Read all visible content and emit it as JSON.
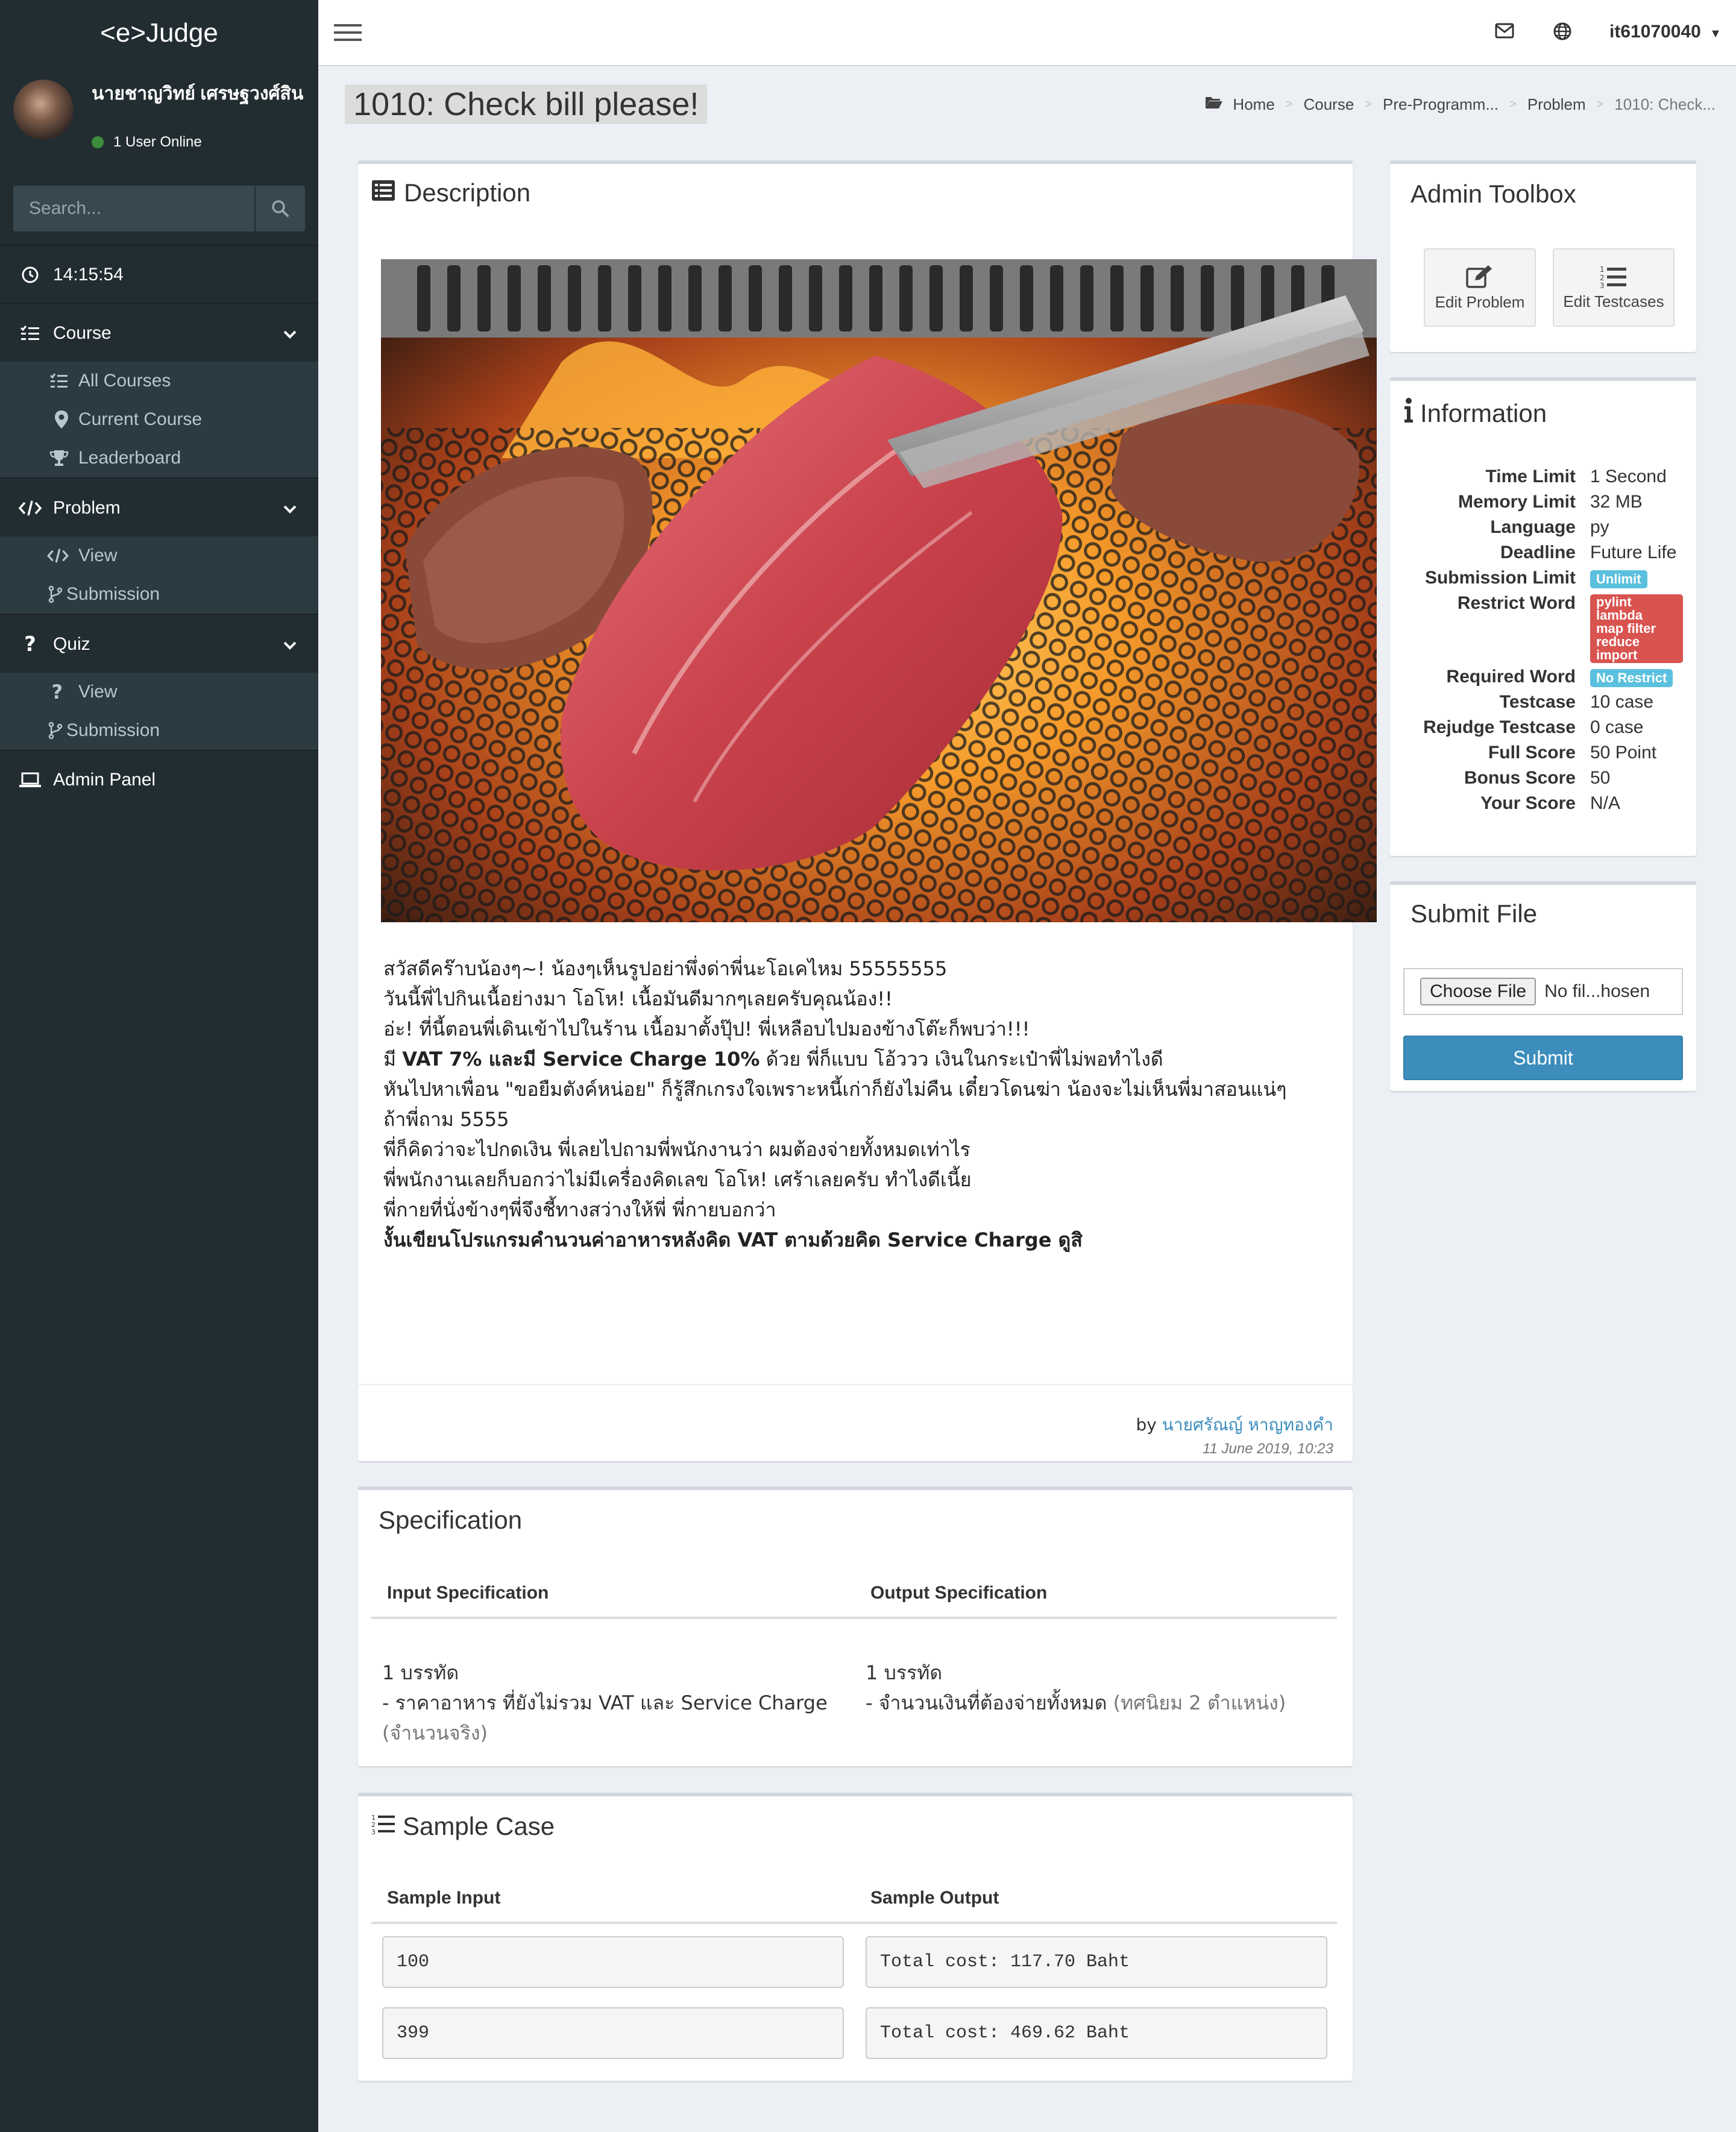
{
  "app": {
    "logo": "<e>Judge"
  },
  "user": {
    "name": "นายชาญวิทย์ เศรษฐวงศ์สิน",
    "status": "1 User Online",
    "account": "it61070040"
  },
  "search": {
    "placeholder": "Search..."
  },
  "sidebar": {
    "clock": "14:15:54",
    "course": {
      "label": "Course",
      "items": [
        "All Courses",
        "Current Course",
        "Leaderboard"
      ]
    },
    "problem": {
      "label": "Problem",
      "items": [
        "View",
        "Submission"
      ]
    },
    "quiz": {
      "label": "Quiz",
      "items": [
        "View",
        "Submission"
      ]
    },
    "admin": "Admin Panel"
  },
  "page": {
    "title": "1010: Check bill please!"
  },
  "breadcrumb": [
    "Home",
    "Course",
    "Pre-Programm...",
    "Problem",
    "1010: Check..."
  ],
  "description": {
    "title": "Description",
    "lines": [
      "สวัสดีคร๊าบน้องๆ~! น้องๆเห็นรูปอย่าพึ่งด่าพี่นะโอเคไหม 55555555",
      "วันนี้พี่ไปกินเนื้อย่างมา โอโห! เนื้อมันดีมากๆเลยครับคุณน้อง!!",
      "อ่ะ! ที่นี้ตอนพี่เดินเข้าไปในร้าน เนื้อมาตั้งปุ๊ป! พี่เหลือบไปมองข้างโต๊ะก็พบว่า!!!"
    ],
    "vat_line": {
      "pre": "มี ",
      "bold": "VAT 7% และมี Service Charge 10%",
      "post": " ด้วย พี่ก็แบบ โอ้ววว เงินในกระเป๋าพี่ไม่พอทำไงดี"
    },
    "lines2": [
      "หันไปหาเพื่อน \"ขอยืมตังค์หน่อย\" ก็รู้สึกเกรงใจเพราะหนี้เก่าก็ยังไม่คืน เดี๋ยวโดนฆ่า น้องจะไม่เห็นพี่มาสอนแน่ๆ",
      "ถ้าพี่ถาม 5555",
      "พี่ก็คิดว่าจะไปกดเงิน พี่เลยไปถามพี่พนักงานว่า ผมต้องจ่ายทั้งหมดเท่าไร",
      "พี่พนักงานเลยก็บอกว่าไม่มีเครื่องคิดเลข โอโห! เศร้าเลยครับ ทำไงดีเนี้ย",
      "พี่กายที่นั่งข้างๆพี่จึงชี้ทางสว่างให้พี่ พี่กายบอกว่า"
    ],
    "final": "งั้นเขียนโปรแกรมคำนวนค่าอาหารหลังคิด VAT ตามด้วยคิด Service Charge ดูสิ",
    "by": "by",
    "author": "นายศรัณญ์ หาญทองคำ",
    "date": "11 June 2019, 10:23"
  },
  "specification": {
    "title": "Specification",
    "input_header": "Input Specification",
    "output_header": "Output Specification",
    "input_line1": "1 บรรทัด",
    "input_line2": " - ราคาอาหาร ที่ยังไม่รวม VAT และ Service Charge",
    "input_note": "(จำนวนจริง)",
    "output_line1": "1 บรรทัด",
    "output_line2": " - จำนวนเงินที่ต้องจ่ายทั้งหมด",
    "output_note": "(ทศนิยม 2 ตำแหน่ง)"
  },
  "sample": {
    "title": "Sample Case",
    "input_header": "Sample Input",
    "output_header": "Sample Output",
    "rows": [
      {
        "input": "100",
        "output": "Total cost: 117.70 Baht"
      },
      {
        "input": "399",
        "output": "Total cost: 469.62 Baht"
      }
    ]
  },
  "toolbox": {
    "title": "Admin Toolbox",
    "edit_problem": "Edit Problem",
    "edit_testcases": "Edit Testcases"
  },
  "information": {
    "title": "Information",
    "time_limit": {
      "label": "Time Limit",
      "value": "1 Second"
    },
    "memory_limit": {
      "label": "Memory Limit",
      "value": "32 MB"
    },
    "language": {
      "label": "Language",
      "value": "py"
    },
    "deadline": {
      "label": "Deadline",
      "value": "Future Life"
    },
    "submission_limit": {
      "label": "Submission Limit",
      "value": "Unlimit"
    },
    "restrict_word": {
      "label": "Restrict Word",
      "values": [
        "pylint",
        "lambda",
        "map filter",
        "reduce",
        "import"
      ]
    },
    "required_word": {
      "label": "Required Word",
      "value": "No Restrict"
    },
    "testcase": {
      "label": "Testcase",
      "value": "10 case"
    },
    "rejudge": {
      "label": "Rejudge Testcase",
      "value": "0 case"
    },
    "full_score": {
      "label": "Full Score",
      "value": "50 Point"
    },
    "bonus_score": {
      "label": "Bonus Score",
      "value": "50"
    },
    "your_score": {
      "label": "Your Score",
      "value": "N/A"
    }
  },
  "submit": {
    "title": "Submit File",
    "choose": "Choose File",
    "no_file": "No fil...hosen",
    "button": "Submit"
  },
  "colors": {
    "sidebar": "#222d32",
    "primary": "#3c8dbc",
    "info_badge": "#5bc0de",
    "danger_badge": "#d9534f",
    "body_bg": "#ecf0f5"
  }
}
